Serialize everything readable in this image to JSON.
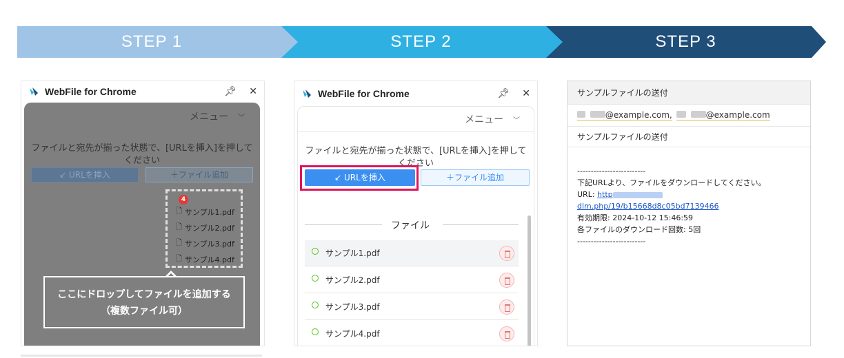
{
  "steps": [
    {
      "label": "STEP 1",
      "color": "#9fc4e6"
    },
    {
      "label": "STEP 2",
      "color": "#2fb0e3"
    },
    {
      "label": "STEP 3",
      "color": "#1f4e79"
    }
  ],
  "extension": {
    "title": "WebFile for Chrome",
    "menu_label": "メニュー",
    "instruction": "ファイルと宛先が揃った状態で、[URLを挿入]を押してください",
    "insert_url_button": "↙ URLを挿入",
    "add_file_button": "＋ファイル追加"
  },
  "step1": {
    "badge_count": "4",
    "drag_files": [
      "サンプル1.pdf",
      "サンプル2.pdf",
      "サンプル3.pdf",
      "サンプル4.pdf"
    ],
    "callout_line1": "ここにドロップしてファイルを追加する",
    "callout_line2": "（複数ファイル可）"
  },
  "step2": {
    "section_title": "ファイル",
    "files": [
      {
        "name": "サンプル1.pdf"
      },
      {
        "name": "サンプル2.pdf"
      },
      {
        "name": "サンプル3.pdf"
      },
      {
        "name": "サンプル4.pdf"
      }
    ]
  },
  "step3": {
    "header_subject": "サンプルファイルの送付",
    "to_addr1": "@example.com,",
    "to_addr2": "@example.com",
    "subject": "サンプルファイルの送付",
    "separator": "-------------------------",
    "line1": "下記URLより、ファイルをダウンロードしてください。",
    "url_prefix": "URL: ",
    "url_start": "http",
    "url_end": "dlm.php/19/b15668d8c05bd7139466",
    "expiry": "有効期限: 2024-10-12 15:46:59",
    "download_limit": "各ファイルのダウンロード回数: 5回"
  }
}
